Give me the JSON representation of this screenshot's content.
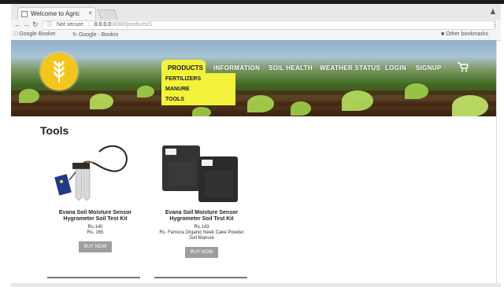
{
  "browser": {
    "tab_title": "Welcome to Agric",
    "tab_close": "×",
    "url_security": "Not secure",
    "url_host": "0.0.0.0",
    "url_path": ":8080/products/1",
    "bookmarks": [
      "Google Bookm",
      "Google - Bookm"
    ],
    "other_bookmarks": "Other bookmarks"
  },
  "nav": {
    "items": [
      "PRODUCTS",
      "INFORMATION",
      "SOIL HEALTH",
      "WEATHER STATUS",
      "LOGIN",
      "SIGNUP"
    ],
    "dropdown": [
      "FERTILIZERS",
      "MANURE",
      "TOOLS"
    ]
  },
  "section": {
    "title": "Tools"
  },
  "products": [
    {
      "name_line1": "Evana Soil Moisture Sensor",
      "name_line2": "Hygrometer Soil Test Kit",
      "price1": "Rs.140",
      "price2": "Rs. 165",
      "desc_line1": "",
      "desc_line2": "",
      "button": "BUY NOW"
    },
    {
      "name_line1": "Evana Soil Moisture Sensor",
      "name_line2": "Hygrometer Soil Test Kit",
      "price1": "Rs.143",
      "price2": "",
      "desc_line1": "Rs. Femora Organic Neek Cake Powder",
      "desc_line2": "Soil Manure",
      "button": "BUY NOW"
    }
  ],
  "colors": {
    "nav_highlight": "#f2f23b",
    "logo": "#f3c51d",
    "button": "#9e9e9e"
  }
}
